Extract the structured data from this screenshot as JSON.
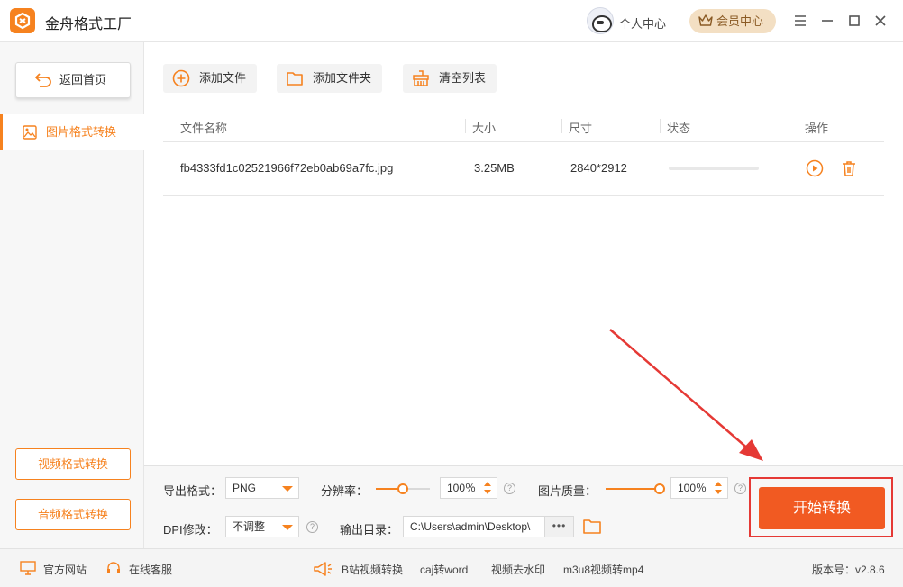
{
  "app": {
    "title": "金舟格式工厂",
    "logo_icon": "app-logo-icon"
  },
  "header": {
    "personal_center": "个人中心",
    "vip_center": "会员中心"
  },
  "sidebar": {
    "back_home": "返回首页",
    "active_item": "图片格式转换",
    "video_convert": "视频格式转换",
    "audio_convert": "音频格式转换"
  },
  "toolbar": {
    "add_file": "添加文件",
    "add_folder": "添加文件夹",
    "clear_list": "清空列表"
  },
  "table": {
    "columns": [
      "文件名称",
      "大小",
      "尺寸",
      "状态",
      "操作"
    ],
    "rows": [
      {
        "name": "fb4333fd1c02521966f72eb0ab69a7fc.jpg",
        "size": "3.25MB",
        "dimensions": "2840*2912",
        "progress": 0
      }
    ]
  },
  "settings": {
    "export_format_label": "导出格式：",
    "export_format_value": "PNG",
    "resolution_label": "分辨率：",
    "resolution_value": "100％",
    "resolution_percent": 100,
    "quality_label": "图片质量：",
    "quality_value": "100％",
    "quality_percent": 100,
    "dpi_label": "DPI修改：",
    "dpi_value": "不调整",
    "output_dir_label": "输出目录：",
    "output_dir_value": "C:\\Users\\admin\\Desktop\\",
    "browse_more": "•••",
    "start_button": "开始转换"
  },
  "footer": {
    "official_site": "官方网站",
    "online_service": "在线客服",
    "bilibili_convert": "B站视频转换",
    "caj_word": "caj转word",
    "video_watermark": "视频去水印",
    "m3u8_mp4": "m3u8视频转mp4",
    "version": "版本号：v2.8.6"
  },
  "colors": {
    "accent": "#f6821f",
    "start_button": "#f15a22",
    "highlight_border": "#e53935"
  }
}
